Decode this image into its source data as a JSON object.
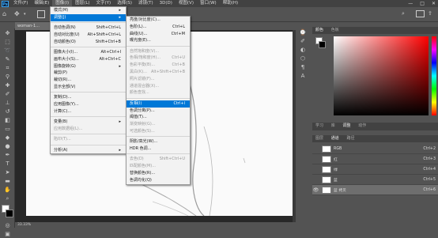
{
  "app": {
    "logo_text": "Ps"
  },
  "menubar": {
    "items": [
      "文件(F)",
      "编辑(E)",
      "图像(I)",
      "图层(L)",
      "文字(Y)",
      "选择(S)",
      "滤镜(T)",
      "3D(D)",
      "视图(V)",
      "窗口(W)",
      "帮助(H)"
    ],
    "window_controls": [
      "—",
      "□",
      "✕"
    ]
  },
  "document": {
    "tab_label": "woman-1..."
  },
  "image_menu": {
    "items": [
      {
        "label": "模式(M)",
        "shortcut": "",
        "submenu": true,
        "state": "normal"
      },
      {
        "label": "调整(J)",
        "shortcut": "",
        "submenu": true,
        "state": "highlighted"
      },
      {
        "sep": true
      },
      {
        "label": "自动色调(N)",
        "shortcut": "Shift+Ctrl+L",
        "state": "normal"
      },
      {
        "label": "自动对比度(U)",
        "shortcut": "Alt+Shift+Ctrl+L",
        "state": "normal"
      },
      {
        "label": "自动颜色(O)",
        "shortcut": "Shift+Ctrl+B",
        "state": "normal"
      },
      {
        "sep": true
      },
      {
        "label": "图像大小(I)...",
        "shortcut": "Alt+Ctrl+I",
        "state": "normal"
      },
      {
        "label": "画布大小(S)...",
        "shortcut": "Alt+Ctrl+C",
        "state": "normal"
      },
      {
        "label": "图像旋转(G)",
        "shortcut": "",
        "submenu": true,
        "state": "normal"
      },
      {
        "label": "裁剪(P)",
        "shortcut": "",
        "state": "normal"
      },
      {
        "label": "裁切(R)...",
        "shortcut": "",
        "state": "normal"
      },
      {
        "label": "显示全部(V)",
        "shortcut": "",
        "state": "normal"
      },
      {
        "sep": true
      },
      {
        "label": "复制(D)...",
        "shortcut": "",
        "state": "normal"
      },
      {
        "label": "应用图像(Y)...",
        "shortcut": "",
        "state": "normal"
      },
      {
        "label": "计算(C)...",
        "shortcut": "",
        "state": "normal"
      },
      {
        "sep": true
      },
      {
        "label": "变量(B)",
        "shortcut": "",
        "submenu": true,
        "state": "normal"
      },
      {
        "label": "应用数据组(L)...",
        "shortcut": "",
        "state": "disabled"
      },
      {
        "sep": true
      },
      {
        "label": "陷印(T)...",
        "shortcut": "",
        "state": "disabled"
      },
      {
        "sep": true
      },
      {
        "label": "分析(A)",
        "shortcut": "",
        "submenu": true,
        "state": "normal"
      }
    ]
  },
  "adjust_menu": {
    "items": [
      {
        "label": "亮度/对比度(C)...",
        "shortcut": "",
        "state": "normal"
      },
      {
        "label": "色阶(L)...",
        "shortcut": "Ctrl+L",
        "state": "normal"
      },
      {
        "label": "曲线(U)...",
        "shortcut": "Ctrl+M",
        "state": "normal"
      },
      {
        "label": "曝光度(E)...",
        "shortcut": "",
        "state": "normal"
      },
      {
        "sep": true
      },
      {
        "label": "自然饱和度(V)...",
        "shortcut": "",
        "state": "disabled"
      },
      {
        "label": "色相/饱和度(H)...",
        "shortcut": "Ctrl+U",
        "state": "disabled"
      },
      {
        "label": "色彩平衡(B)...",
        "shortcut": "Ctrl+B",
        "state": "disabled"
      },
      {
        "label": "黑白(K)...",
        "shortcut": "Alt+Shift+Ctrl+B",
        "state": "disabled"
      },
      {
        "label": "照片滤镜(F)...",
        "shortcut": "",
        "state": "disabled"
      },
      {
        "label": "通道混合器(X)...",
        "shortcut": "",
        "state": "disabled"
      },
      {
        "label": "颜色查找...",
        "shortcut": "",
        "state": "disabled"
      },
      {
        "sep": true
      },
      {
        "label": "反相(I)",
        "shortcut": "Ctrl+I",
        "state": "highlighted"
      },
      {
        "label": "色调分离(P)...",
        "shortcut": "",
        "state": "normal"
      },
      {
        "label": "阈值(T)...",
        "shortcut": "",
        "state": "normal"
      },
      {
        "label": "渐变映射(G)...",
        "shortcut": "",
        "state": "disabled"
      },
      {
        "label": "可选颜色(S)...",
        "shortcut": "",
        "state": "disabled"
      },
      {
        "sep": true
      },
      {
        "label": "阴影/高光(W)...",
        "shortcut": "",
        "state": "normal"
      },
      {
        "label": "HDR 色调...",
        "shortcut": "",
        "state": "normal"
      },
      {
        "sep": true
      },
      {
        "label": "去色(D)",
        "shortcut": "Shift+Ctrl+U",
        "state": "disabled"
      },
      {
        "label": "匹配颜色(M)...",
        "shortcut": "",
        "state": "disabled"
      },
      {
        "label": "替换颜色(R)...",
        "shortcut": "",
        "state": "normal"
      },
      {
        "label": "色调均化(Q)",
        "shortcut": "",
        "state": "normal"
      }
    ]
  },
  "color_panel": {
    "tabs": [
      "颜色",
      "色板"
    ]
  },
  "mid_panel": {
    "tabs": [
      "学习",
      "库",
      "调整",
      "动作"
    ]
  },
  "layers_panel": {
    "tabs": [
      "图层",
      "通道",
      "路径"
    ],
    "channels": [
      {
        "name": "RGB",
        "shortcut": "Ctrl+2",
        "selected": false
      },
      {
        "name": "红",
        "shortcut": "Ctrl+3",
        "selected": false
      },
      {
        "name": "绿",
        "shortcut": "Ctrl+4",
        "selected": false
      },
      {
        "name": "蓝",
        "shortcut": "Ctrl+5",
        "selected": false
      },
      {
        "name": "蓝 拷贝",
        "shortcut": "Ctrl+6",
        "selected": true
      }
    ]
  },
  "status": {
    "zoom": "33.33%"
  },
  "colors": {
    "accent": "#0078d7",
    "hue_red": "#ff0000"
  }
}
